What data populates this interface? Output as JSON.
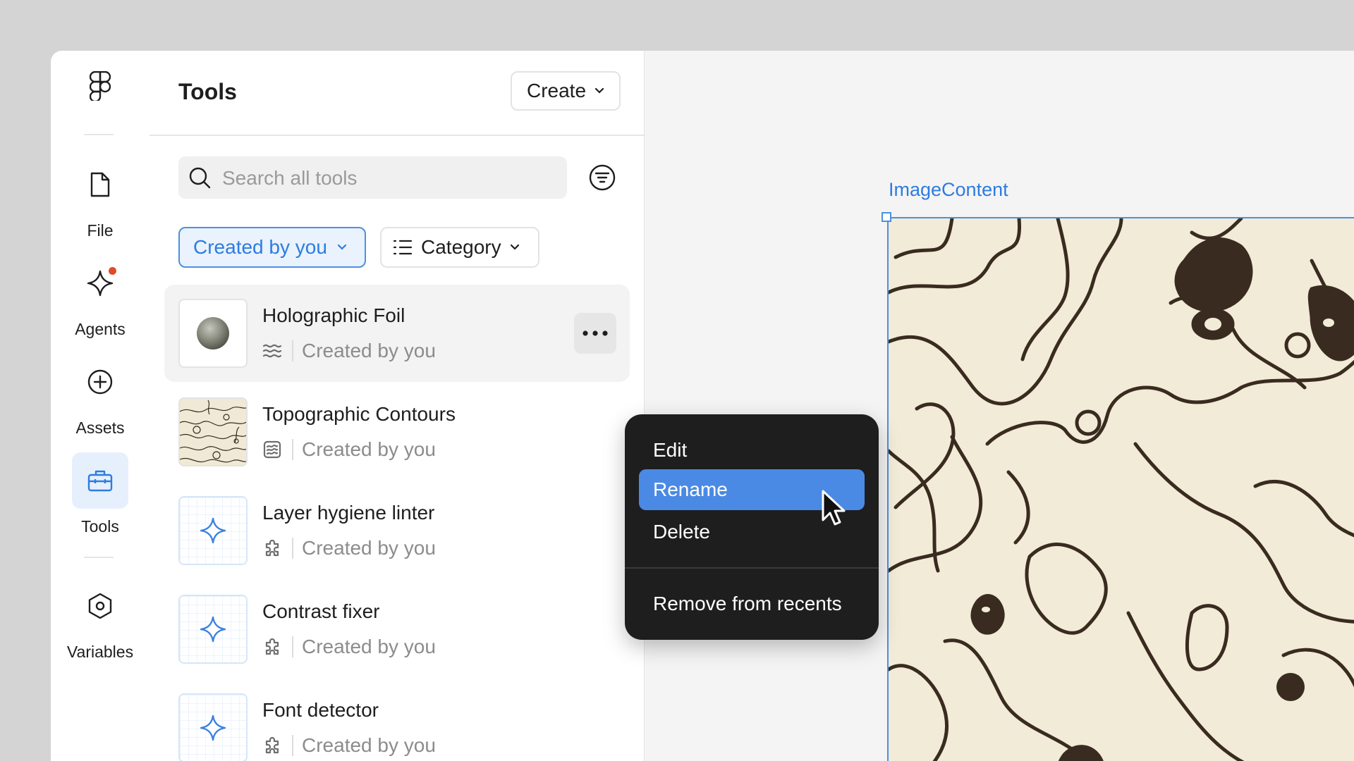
{
  "rail": {
    "items": [
      {
        "label": "File",
        "icon": "file-icon"
      },
      {
        "label": "Agents",
        "icon": "sparkle-icon",
        "has_notification": true
      },
      {
        "label": "Assets",
        "icon": "plus-circle-icon"
      },
      {
        "label": "Tools",
        "icon": "toolbox-icon",
        "active": true
      },
      {
        "label": "Variables",
        "icon": "hexagon-icon"
      }
    ]
  },
  "panel": {
    "title": "Tools",
    "create_label": "Create",
    "search_placeholder": "Search all tools",
    "filters": {
      "created_by": "Created by you",
      "category": "Category"
    },
    "tools": [
      {
        "name": "Holographic Foil",
        "meta": "Created by you",
        "thumb": "sphere",
        "type_icon": "waves-icon"
      },
      {
        "name": "Topographic Contours",
        "meta": "Created by you",
        "thumb": "topo",
        "type_icon": "pattern-icon"
      },
      {
        "name": "Layer hygiene linter",
        "meta": "Created by you",
        "thumb": "sparkle",
        "type_icon": "plugin-icon"
      },
      {
        "name": "Contrast fixer",
        "meta": "Created by you",
        "thumb": "sparkle",
        "type_icon": "plugin-icon"
      },
      {
        "name": "Font detector",
        "meta": "Created by you",
        "thumb": "sparkle",
        "type_icon": "plugin-icon"
      }
    ]
  },
  "context_menu": {
    "items": [
      "Edit",
      "Rename",
      "Delete",
      "Remove from recents"
    ],
    "highlighted": "Rename"
  },
  "canvas": {
    "frame_label": "ImageContent"
  },
  "colors": {
    "accent": "#4a8ae4",
    "accent_text": "#2d7ce0",
    "menu_bg": "#1e1e1e",
    "notification": "#e04b28",
    "topo_bg": "#f2ebd7",
    "topo_line": "#3a2b20"
  }
}
